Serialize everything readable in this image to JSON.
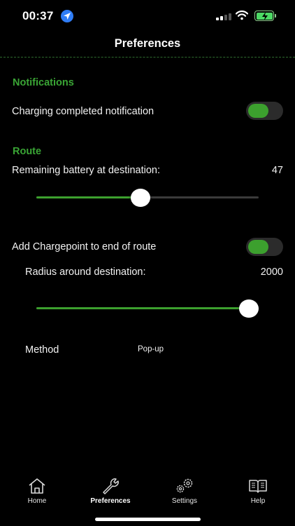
{
  "status_bar": {
    "time": "00:37",
    "icons": [
      "location-arrow-icon",
      "cellular-signal-icon",
      "wifi-icon",
      "battery-charging-icon"
    ]
  },
  "header": {
    "title": "Preferences"
  },
  "notifications": {
    "title": "Notifications",
    "charging_completed": {
      "label": "Charging completed notification",
      "enabled": true
    }
  },
  "route": {
    "title": "Route",
    "remaining_battery": {
      "label": "Remaining battery at destination:",
      "value": "47",
      "level": 0.47
    },
    "add_chargepoint": {
      "label": "Add Chargepoint to end of route",
      "enabled": true
    },
    "radius": {
      "label": "Radius around destination:",
      "value": "2000",
      "level": 1.0
    },
    "method": {
      "label": "Method",
      "value": "Pop-up"
    }
  },
  "tab_bar": {
    "tabs": [
      {
        "label": "Home",
        "icon": "home-icon",
        "active": false
      },
      {
        "label": "Preferences",
        "icon": "wrench-icon",
        "active": true
      },
      {
        "label": "Settings",
        "icon": "gears-icon",
        "active": false
      },
      {
        "label": "Help",
        "icon": "book-icon",
        "active": false
      }
    ]
  },
  "colors": {
    "accent": "#3ca02e",
    "section_title": "#3aa535",
    "background": "#000000"
  }
}
